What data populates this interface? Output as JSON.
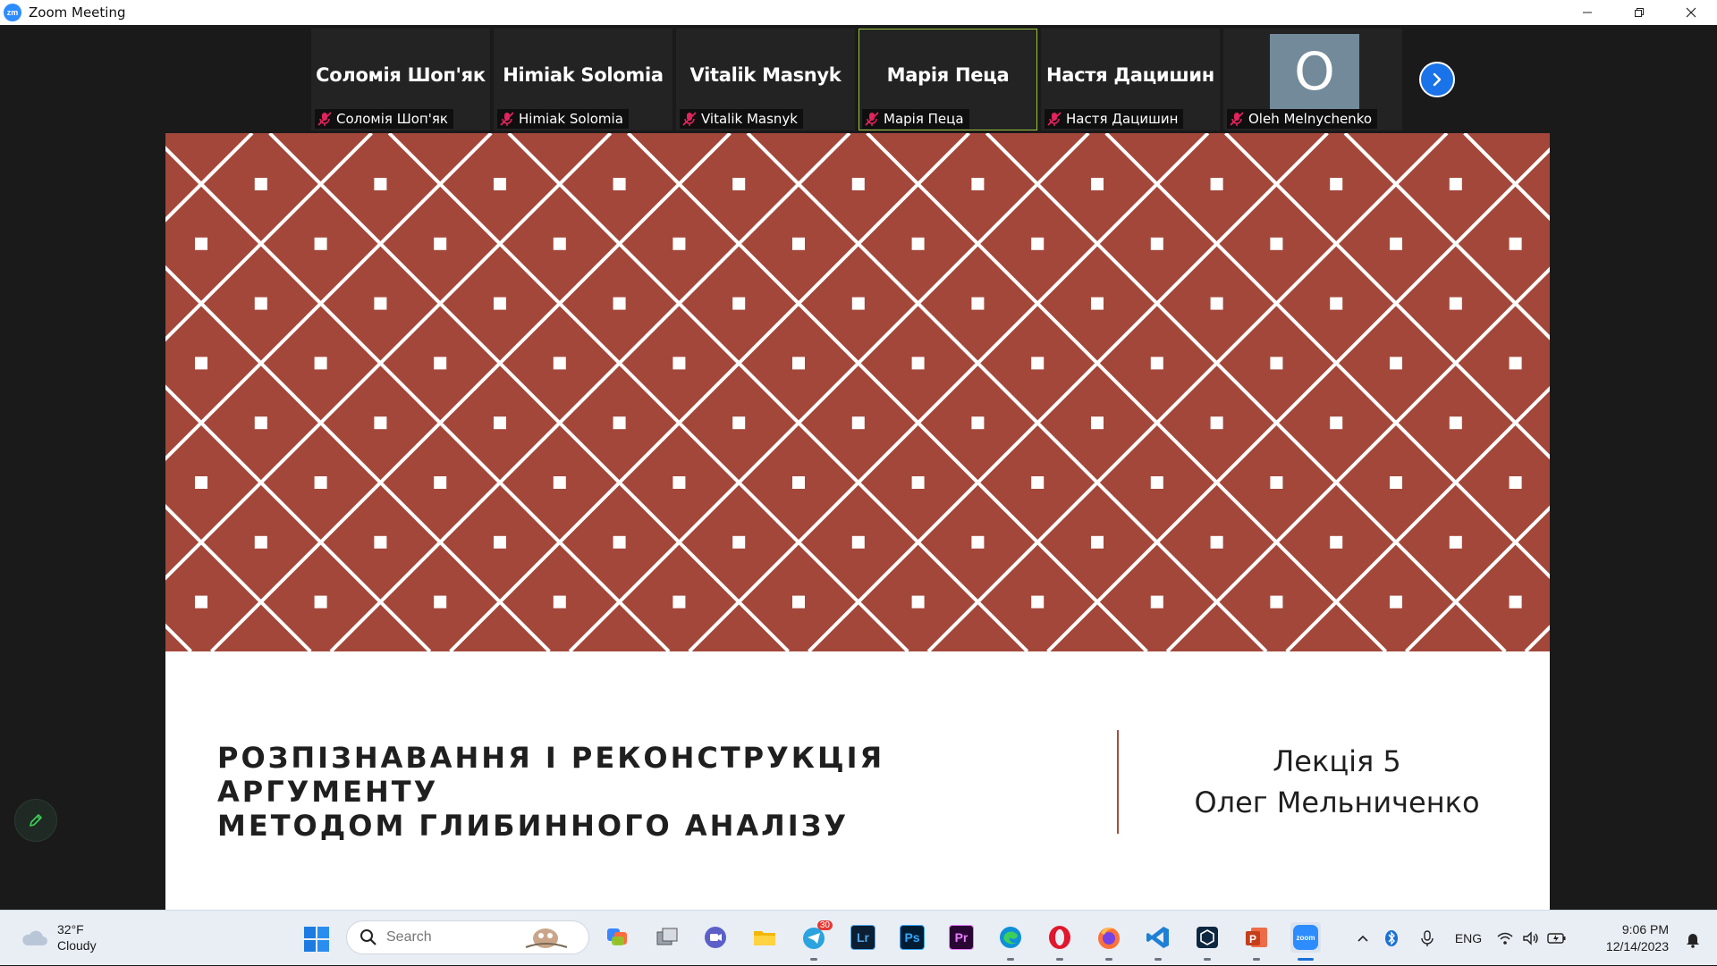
{
  "window": {
    "title": "Zoom Meeting",
    "logo_text": "zm"
  },
  "participants": [
    {
      "display": "Соломія Шоп'як",
      "label": "Соломія Шоп'як",
      "active": false
    },
    {
      "display": "Himiak Solomia",
      "label": "Himiak Solomia",
      "active": false
    },
    {
      "display": "Vitalik Masnyk",
      "label": "Vitalik Masnyk",
      "active": false
    },
    {
      "display": "Марія Пеца",
      "label": "Марія Пеца",
      "active": true
    },
    {
      "display": "Настя Дацишин",
      "label": "Настя Дацишин",
      "active": false
    },
    {
      "display": "O",
      "label": "Oleh Melnychenko",
      "active": false,
      "avatar": true
    }
  ],
  "slide": {
    "title_line1": "РОЗПІЗНАВАННЯ І РЕКОНСТРУКЦІЯ АРГУМЕНТУ",
    "title_line2": "МЕТОДОМ ГЛИБИННОГО АНАЛІЗУ",
    "lecture": "Лекція 5",
    "author": "Олег Мельниченко",
    "pattern_color": "#a3473a",
    "divider_color": "#a94b3a"
  },
  "taskbar": {
    "weather_temp": "32°F",
    "weather_desc": "Cloudy",
    "search_placeholder": "Search",
    "telegram_badge": "30",
    "language": "ENG",
    "time": "9:06 PM",
    "date": "12/14/2023",
    "apps": [
      "copilot-icon",
      "task-view-icon",
      "teams-icon",
      "file-explorer-icon",
      "telegram-icon",
      "lightroom-icon",
      "photoshop-icon",
      "premiere-icon",
      "edge-icon",
      "opera-icon",
      "firefox-icon",
      "vscode-icon",
      "cube-app-icon",
      "powerpoint-icon",
      "zoom-icon"
    ],
    "app_labels": {
      "lightroom": "Lr",
      "photoshop": "Ps",
      "premiere": "Pr",
      "zoom": "zoom"
    }
  }
}
